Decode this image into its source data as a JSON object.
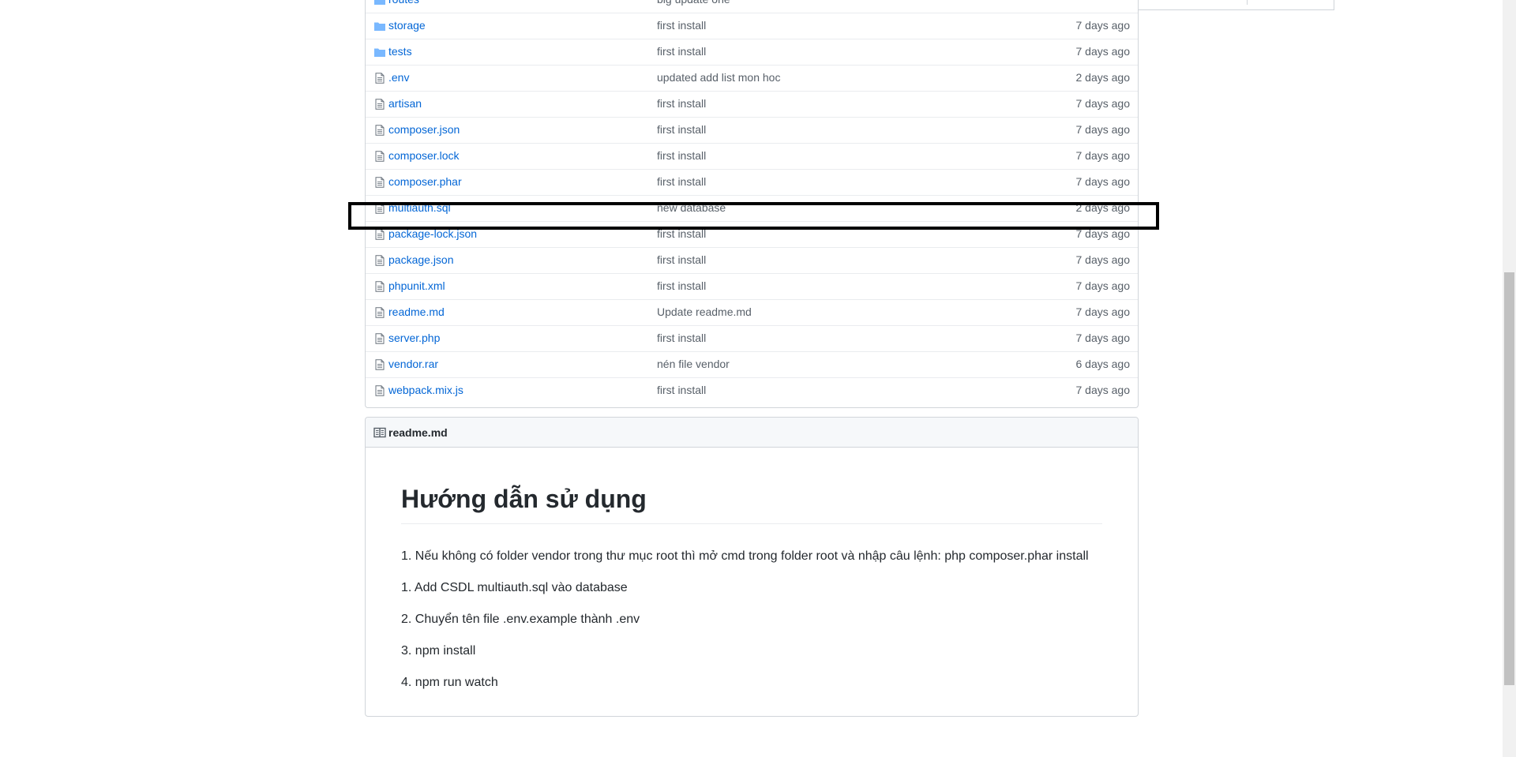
{
  "files": [
    {
      "name": "routes",
      "type": "folder",
      "message": "big update one",
      "age": ""
    },
    {
      "name": "storage",
      "type": "folder",
      "message": "first install",
      "age": "7 days ago"
    },
    {
      "name": "tests",
      "type": "folder",
      "message": "first install",
      "age": "7 days ago"
    },
    {
      "name": ".env",
      "type": "file",
      "message": "updated add list mon hoc",
      "age": "2 days ago"
    },
    {
      "name": "artisan",
      "type": "file",
      "message": "first install",
      "age": "7 days ago"
    },
    {
      "name": "composer.json",
      "type": "file",
      "message": "first install",
      "age": "7 days ago"
    },
    {
      "name": "composer.lock",
      "type": "file",
      "message": "first install",
      "age": "7 days ago"
    },
    {
      "name": "composer.phar",
      "type": "file",
      "message": "first install",
      "age": "7 days ago"
    },
    {
      "name": "multiauth.sql",
      "type": "file",
      "message": "new database",
      "age": "2 days ago"
    },
    {
      "name": "package-lock.json",
      "type": "file",
      "message": "first install",
      "age": "7 days ago"
    },
    {
      "name": "package.json",
      "type": "file",
      "message": "first install",
      "age": "7 days ago"
    },
    {
      "name": "phpunit.xml",
      "type": "file",
      "message": "first install",
      "age": "7 days ago"
    },
    {
      "name": "readme.md",
      "type": "file",
      "message": "Update readme.md",
      "age": "7 days ago"
    },
    {
      "name": "server.php",
      "type": "file",
      "message": "first install",
      "age": "7 days ago"
    },
    {
      "name": "vendor.rar",
      "type": "file",
      "message": "nén file vendor",
      "age": "6 days ago"
    },
    {
      "name": "webpack.mix.js",
      "type": "file",
      "message": "first install",
      "age": "7 days ago"
    }
  ],
  "readme": {
    "header_icon": "book-icon",
    "title": "readme.md",
    "heading": "Hướng dẫn sử dụng",
    "paragraphs": [
      "1. Nếu không có folder vendor trong thư mục root thì mở cmd trong folder root và nhập câu lệnh: php composer.phar install",
      "1. Add CSDL multiauth.sql vào database",
      "2. Chuyển tên file .env.example thành .env",
      "3. npm install",
      "4. npm run watch"
    ]
  },
  "icons": {
    "folder": "folder-icon",
    "file": "file-icon"
  },
  "colors": {
    "link": "#0366d6",
    "muted": "#586069",
    "folder_icon": "#79b8ff",
    "highlight": "#000000"
  }
}
